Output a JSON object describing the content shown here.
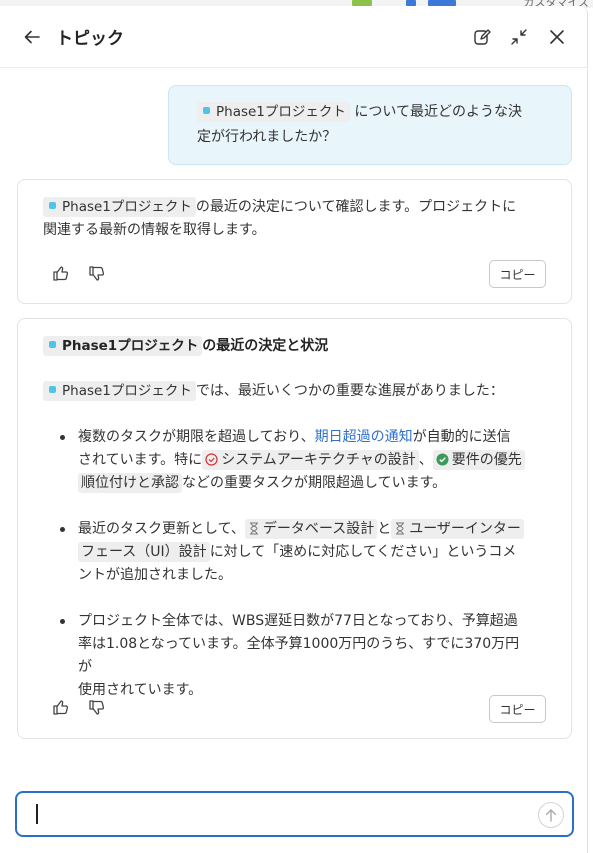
{
  "header": {
    "title": "トピック"
  },
  "background": {
    "customize_label": "カスタマイズ"
  },
  "user_message": {
    "pill": "Phase1プロジェクト",
    "text_part1": "について最近どのような決",
    "text_part2": "定が行われましたか？"
  },
  "reply1": {
    "pill": "Phase1プロジェクト",
    "text_part1": "の最近の決定について確認します。プロジェクトに",
    "text_part2": "関連する最新の情報を取得します。",
    "copy_label": "コピー"
  },
  "reply2": {
    "heading_pill": "Phase1プロジェクト",
    "heading_rest": "の最近の決定と状況",
    "intro_pill": "Phase1プロジェクト",
    "intro_rest": "では、最近いくつかの重要な進展がありました：",
    "bullet1": {
      "a": "複数のタスクが期限を超過しており、",
      "link": "期日超過の通知",
      "b": "が自動的に送信",
      "c": "されています。特に",
      "tag1": "システムアーキテクチャの設計",
      "d": "、",
      "tag2a": "要件の優先",
      "tag2b": "順位付けと承認",
      "e": "などの重要タスクが期限超過しています。"
    },
    "bullet2": {
      "a": "最近のタスク更新として、",
      "tag1": "データベース設計",
      "b": "と",
      "tag2a": "ユーザーインター",
      "tag2b": "フェース（UI）設計",
      "c": "に対して「速めに対応してください」というコメ",
      "d": "ントが追加されました。"
    },
    "bullet3": {
      "line1": "プロジェクト全体では、WBS遅延日数が77日となっており、予算超過",
      "line2": "率は1.08となっています。全体予算1000万円のうち、すでに370万円が",
      "line3": "使用されています。"
    },
    "copy_label": "コピー"
  },
  "input": {
    "value": ""
  },
  "colors": {
    "accent": "#2b6fc9",
    "user_bubble": "#e8f5fb",
    "link": "#2f6fd0",
    "pill_dot": "#4fc3e8"
  },
  "icons": {
    "back": "arrow-left-icon",
    "edit": "edit-icon",
    "collapse": "collapse-icon",
    "close": "close-icon",
    "like": "thumbs-up-icon",
    "dislike": "thumbs-down-icon",
    "send": "arrow-up-icon",
    "overdue": "error-circle-icon",
    "done": "check-circle-icon",
    "pending": "hourglass-icon"
  }
}
